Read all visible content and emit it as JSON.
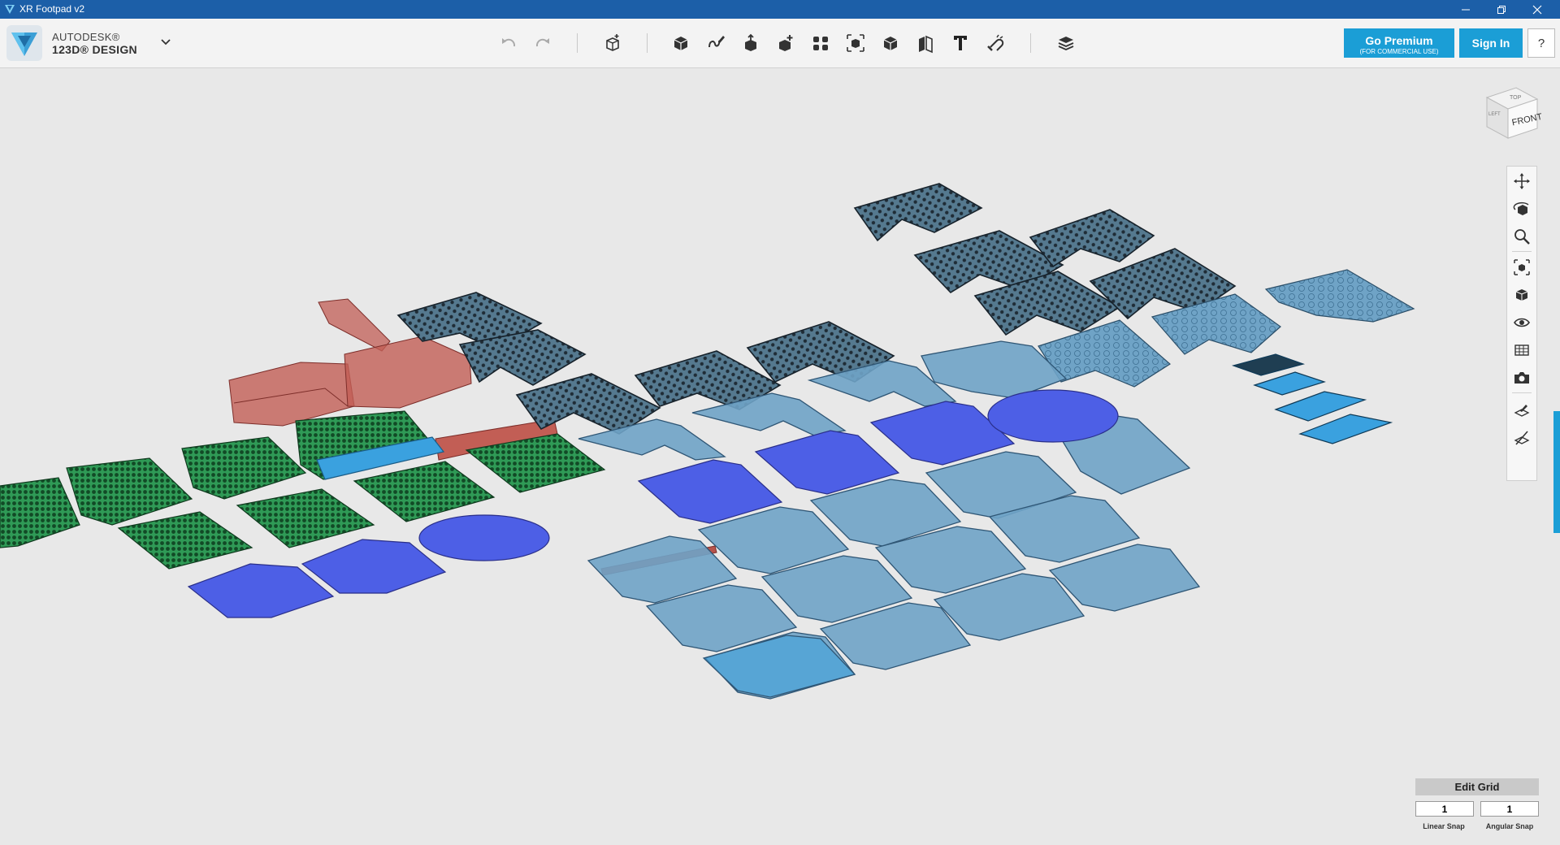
{
  "window": {
    "title": "XR Footpad v2",
    "controls": {
      "minimize": "minimize-icon",
      "restore": "restore-icon",
      "close": "close-icon"
    }
  },
  "brand": {
    "line1": "AUTODESK®",
    "line2": "123D® DESIGN"
  },
  "toolbar": {
    "tools": [
      "undo-icon",
      "redo-icon",
      "transform-icon",
      "primitives-icon",
      "sketch-icon",
      "construct-icon",
      "modify-icon",
      "pattern-icon",
      "group-icon",
      "combine-icon",
      "measure-icon",
      "text-icon",
      "snap-icon",
      "material-icon"
    ]
  },
  "account": {
    "premium_label": "Go Premium",
    "premium_sub": "(FOR COMMERCIAL USE)",
    "signin_label": "Sign In",
    "help_label": "?"
  },
  "viewcube": {
    "top": "TOP",
    "front": "FRONT",
    "left": "LEFT"
  },
  "navbar": {
    "buttons": [
      "pan-icon",
      "orbit-icon",
      "zoom-icon",
      "fit-icon",
      "view-mode-icon",
      "visibility-icon",
      "materials-outlines-icon",
      "screenshot-icon",
      "snap-grid-icon",
      "hide-grid-icon"
    ]
  },
  "grid": {
    "edit_label": "Edit Grid",
    "linear_value": "1",
    "angular_value": "1",
    "linear_label": "Linear Snap",
    "angular_label": "Angular Snap"
  },
  "colors": {
    "titlebar": "#1c5fa8",
    "accent": "#1b9ed6",
    "part_blue": "#6fa3c6",
    "part_violet": "#4d5fe6",
    "part_green": "#2f9a56",
    "part_red": "#c25e55",
    "part_bright": "#3aa1df"
  }
}
